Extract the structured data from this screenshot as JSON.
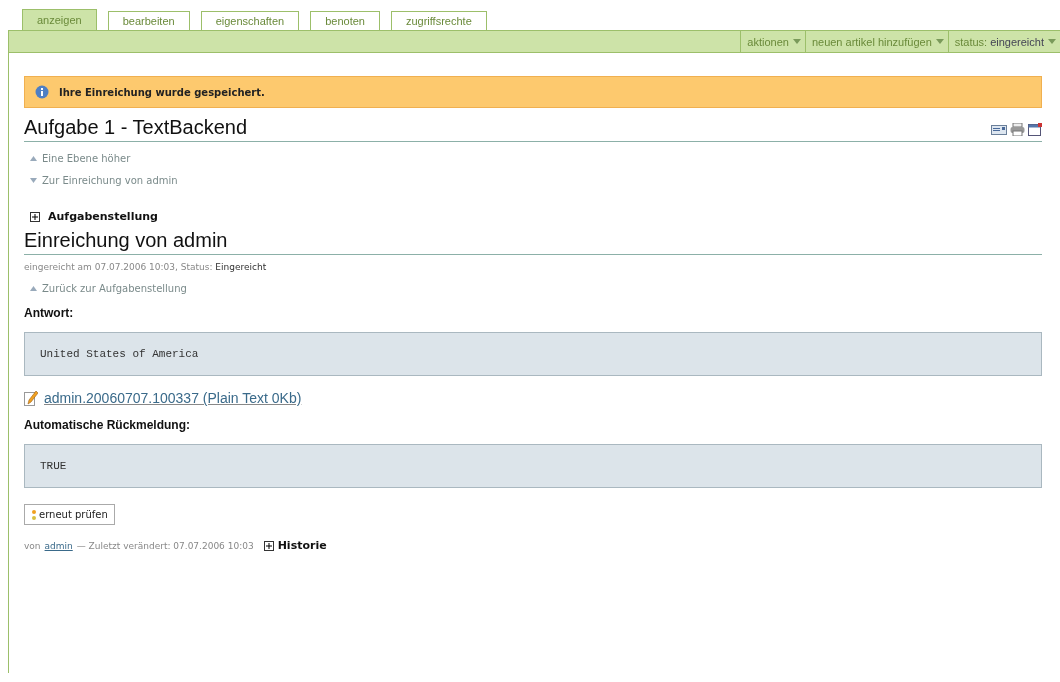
{
  "tabs": [
    {
      "label": "anzeigen",
      "selected": true
    },
    {
      "label": "bearbeiten",
      "selected": false
    },
    {
      "label": "eigenschaften",
      "selected": false
    },
    {
      "label": "benoten",
      "selected": false
    },
    {
      "label": "zugriffsrechte",
      "selected": false
    }
  ],
  "action_menus": [
    {
      "label": "aktionen"
    },
    {
      "label": "neuen artikel hinzufügen"
    },
    {
      "label": "status:",
      "value": "eingereicht"
    }
  ],
  "message": "Ihre Einreichung wurde gespeichert.",
  "title": "Aufgabe 1 - TextBackend",
  "nav_links": [
    {
      "label": "Eine Ebene höher",
      "kind": "up"
    },
    {
      "label": "Zur Einreichung von admin",
      "kind": "down"
    }
  ],
  "assignment_toggle": {
    "label": "Aufgabenstellung",
    "expanded": false
  },
  "submission": {
    "heading": "Einreichung von admin",
    "meta": "eingereicht am 07.07.2006 10:03, Status:",
    "status": "Eingereicht",
    "back_link": "Zurück zur Aufgabenstellung",
    "answer_label": "Antwort:",
    "answer": "United States of America",
    "file_link": "admin.20060707.100337 (Plain Text 0Kb)",
    "feedback_label": "Automatische Rückmeldung:",
    "feedback": "TRUE",
    "recheck_button": "erneut prüfen"
  },
  "byline": {
    "prefix": "von",
    "author": "admin",
    "modified": "— Zuletzt verändert: 07.07.2006 10:03",
    "history": {
      "label": "Historie",
      "expanded": false
    }
  }
}
